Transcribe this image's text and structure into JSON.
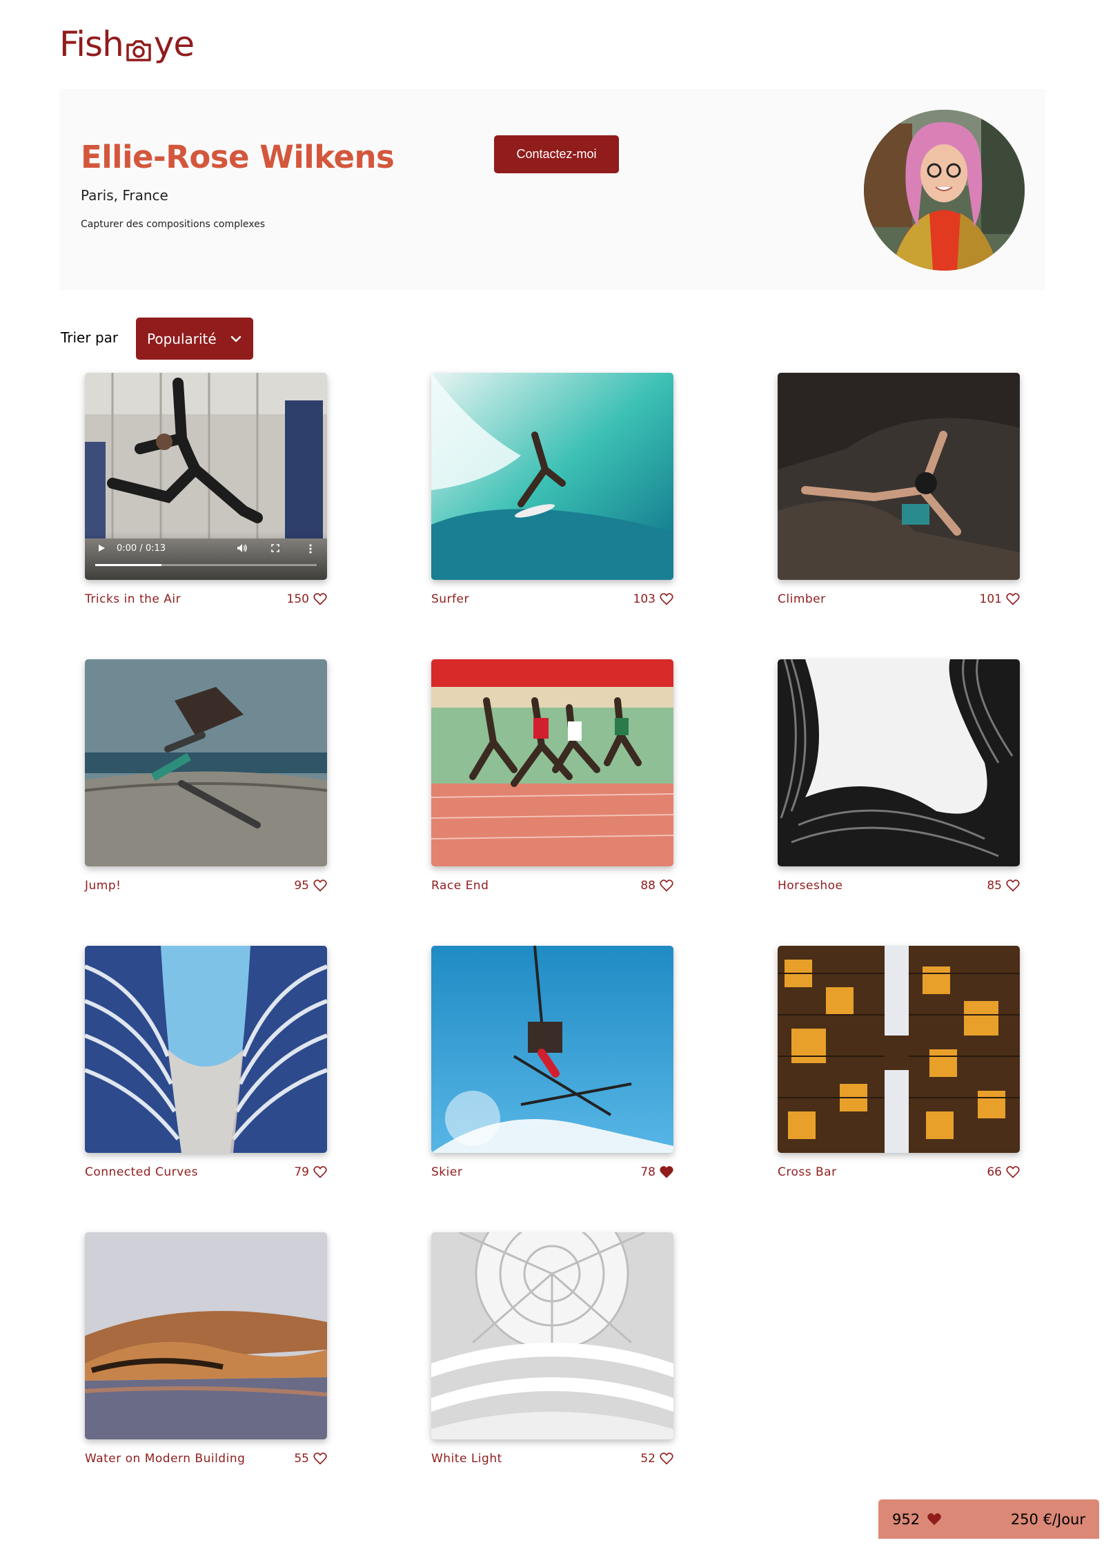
{
  "logo": {
    "text_before": "Fish",
    "text_after": "ye"
  },
  "photographer": {
    "name": "Ellie-Rose Wilkens",
    "location": "Paris, France",
    "tagline": "Capturer des compositions complexes",
    "contact_label": "Contactez-moi"
  },
  "sort": {
    "label": "Trier par",
    "selected": "Popularité"
  },
  "video_controls": {
    "time": "0:00 / 0:13",
    "progress": 0.3
  },
  "media": [
    {
      "title": "Tricks in the Air",
      "likes": "150",
      "liked": false,
      "kind": "video"
    },
    {
      "title": "Surfer",
      "likes": "103",
      "liked": false,
      "kind": "image"
    },
    {
      "title": "Climber",
      "likes": "101",
      "liked": false,
      "kind": "image"
    },
    {
      "title": "Jump!",
      "likes": "95",
      "liked": false,
      "kind": "image"
    },
    {
      "title": "Race End",
      "likes": "88",
      "liked": false,
      "kind": "image"
    },
    {
      "title": "Horseshoe",
      "likes": "85",
      "liked": false,
      "kind": "image"
    },
    {
      "title": "Connected Curves",
      "likes": "79",
      "liked": false,
      "kind": "image"
    },
    {
      "title": "Skier",
      "likes": "78",
      "liked": true,
      "kind": "image"
    },
    {
      "title": "Cross Bar",
      "likes": "66",
      "liked": false,
      "kind": "image"
    },
    {
      "title": "Water on Modern Building",
      "likes": "55",
      "liked": false,
      "kind": "image"
    },
    {
      "title": "White Light",
      "likes": "52",
      "liked": false,
      "kind": "image"
    }
  ],
  "totals": {
    "likes": "952",
    "price": "250 €/Jour"
  },
  "colors": {
    "primary": "#901c1c",
    "accent": "#d3573c",
    "totals_bg": "#db8876",
    "header_bg": "#fafafa"
  },
  "icons": {
    "like": "heart-icon",
    "sort_chevron": "chevron-down-icon",
    "logo": "camera-icon"
  }
}
